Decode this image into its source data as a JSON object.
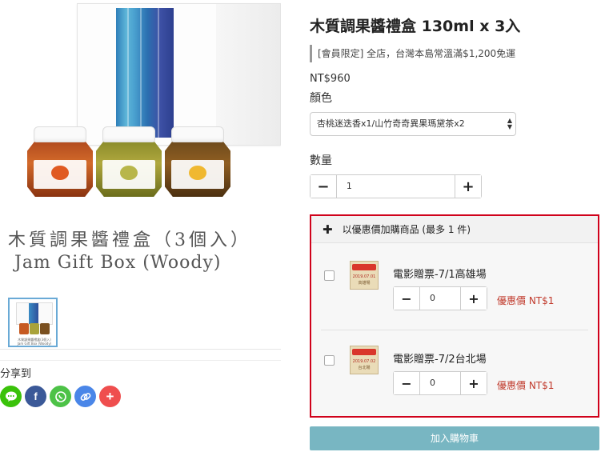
{
  "product": {
    "title": "木質調果醬禮盒 130ml x 3入",
    "promo": "[會員限定] 全店，台灣本島常溫滿$1,200免運",
    "price": "NT$960",
    "variant_label": "顏色",
    "variant_selected": "杏桃迷迭香x1/山竹奇奇異果瑪黛茶x2",
    "quantity_label": "數量",
    "quantity_value": "1",
    "add_to_cart": "加入購物車"
  },
  "gallery": {
    "caption_cn": "木質調果醬禮盒（3個入）",
    "caption_en": "Jam Gift Box (Woody)",
    "thumbnail_caption_cn": "木質調果醬禮盒(3個入)",
    "thumbnail_caption_en": "Jam Gift Box (Woody)"
  },
  "share": {
    "label": "分享到",
    "buttons": [
      {
        "name": "line",
        "color": "#3ac20a"
      },
      {
        "name": "facebook",
        "color": "#3b5998"
      },
      {
        "name": "whatsapp",
        "color": "#4dc247"
      },
      {
        "name": "copy-link",
        "color": "#4a86e8"
      },
      {
        "name": "more",
        "color": "#ef4e4e"
      }
    ]
  },
  "addon": {
    "header": "以優惠價加購商品 (最多 1 件)",
    "items": [
      {
        "name": "電影贈票-7/1高雄場",
        "quantity": "0",
        "deal": "優惠價 NT$1",
        "ticket_date": "2019.07.01",
        "ticket_place": "高雄場"
      },
      {
        "name": "電影贈票-7/2台北場",
        "quantity": "0",
        "deal": "優惠價 NT$1",
        "ticket_date": "2019.07.02",
        "ticket_place": "台北場"
      }
    ]
  },
  "colors": {
    "addon_border": "#d0021b",
    "cart_button": "#78b6c2",
    "deal_text": "#c0392b"
  }
}
